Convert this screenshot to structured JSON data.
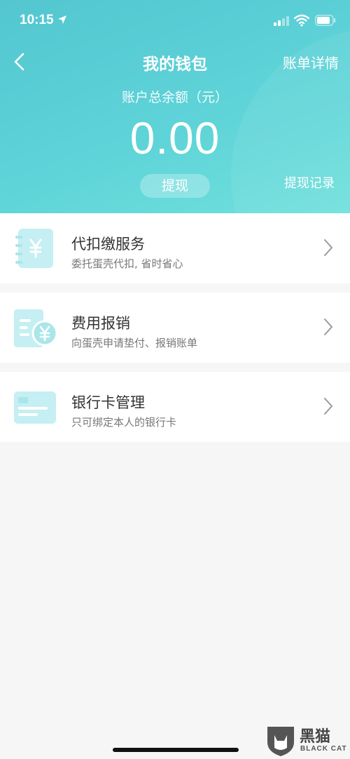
{
  "status_bar": {
    "time": "10:15"
  },
  "nav": {
    "title": "我的钱包",
    "right_label": "账单详情"
  },
  "balance": {
    "label": "账户总余额（元）",
    "amount": "0.00"
  },
  "actions": {
    "withdraw_label": "提现",
    "withdraw_record_label": "提现记录"
  },
  "menu": [
    {
      "title": "代扣缴服务",
      "subtitle": "委托蛋壳代扣, 省时省心",
      "icon": "yen-notebook-icon"
    },
    {
      "title": "费用报销",
      "subtitle": "向蛋壳申请垫付、报销账单",
      "icon": "yen-receipt-icon"
    },
    {
      "title": "银行卡管理",
      "subtitle": "只可绑定本人的银行卡",
      "icon": "bank-card-icon"
    }
  ],
  "watermark": {
    "text": "黑猫",
    "sub": "BLACK CAT"
  },
  "colors": {
    "header_gradient_start": "#53c6cf",
    "header_gradient_end": "#6fe0dc",
    "icon_fill": "#c5eff2",
    "icon_accent": "#a9e6ea"
  }
}
